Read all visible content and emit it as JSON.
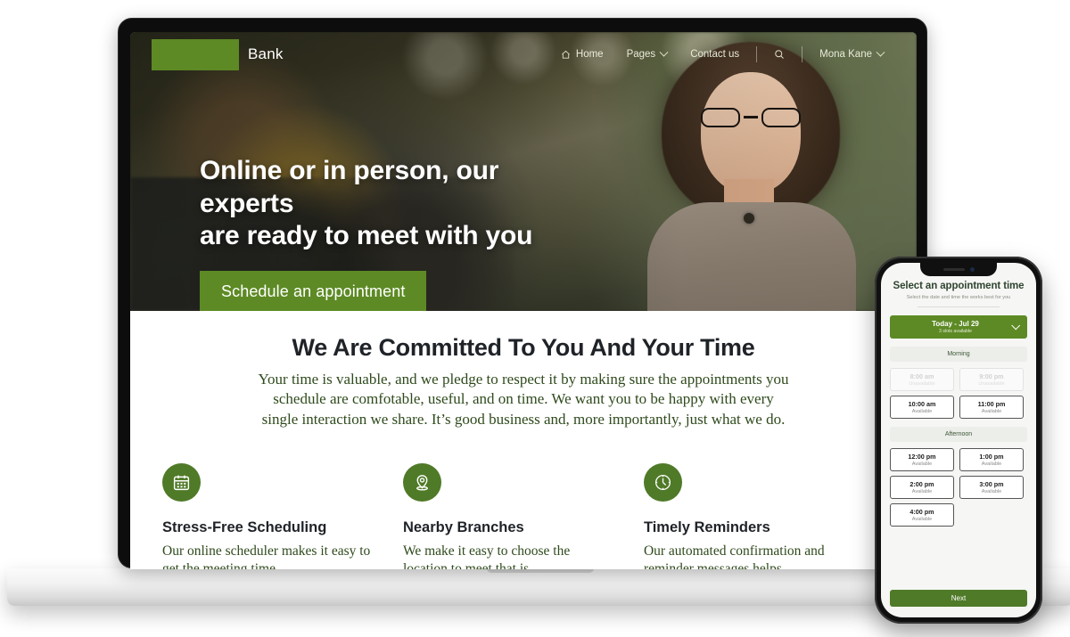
{
  "desktop": {
    "nav": {
      "logo_text": "Bank",
      "items": [
        {
          "label": "Home",
          "icon": "home-icon",
          "has_chevron": false
        },
        {
          "label": "Pages",
          "icon": "",
          "has_chevron": true
        },
        {
          "label": "Contact us",
          "icon": "",
          "has_chevron": false
        }
      ],
      "search_icon": "search-icon",
      "account_label": "Mona Kane",
      "account_chevron": "chevron-down-icon"
    },
    "hero": {
      "headline_line1": "Online or in person, our experts",
      "headline_line2": "are ready to meet with you",
      "cta_label": "Schedule an appointment"
    },
    "section": {
      "title": "We Are Committed To You And Your Time",
      "body": "Your time is valuable, and we pledge to respect it by making sure the appointments you schedule are comfotable, useful, and on time. We want you to be happy with every single interaction we share. It’s good business and, more importantly, just what we do.",
      "features": [
        {
          "icon": "calendar-icon",
          "title": "Stress-Free Scheduling",
          "text": "Our online scheduler makes it easy to get the meeting time"
        },
        {
          "icon": "location-pin-icon",
          "title": "Nearby Branches",
          "text": "We make it easy to choose the location to meet that is"
        },
        {
          "icon": "clock-icon",
          "title": "Timely Reminders",
          "text": "Our automated confirmation and reminder messages helps"
        }
      ]
    }
  },
  "phone": {
    "title": "Select an appointment time",
    "subtitle": "Select the date and time the works best for you",
    "date_select": {
      "label": "Today - Jul 29",
      "sublabel": "3 slots available",
      "chevron": "chevron-down-icon"
    },
    "groups": [
      {
        "label": "Morning",
        "slots": [
          {
            "time": "8:00 am",
            "status": "Unavailable",
            "available": false
          },
          {
            "time": "9:00 pm",
            "status": "Unavailable",
            "available": false
          },
          {
            "time": "10:00 am",
            "status": "Available",
            "available": true
          },
          {
            "time": "11:00 pm",
            "status": "Available",
            "available": true
          }
        ]
      },
      {
        "label": "Afternoon",
        "slots": [
          {
            "time": "12:00 pm",
            "status": "Available",
            "available": true
          },
          {
            "time": "1:00 pm",
            "status": "Available",
            "available": true
          },
          {
            "time": "2:00 pm",
            "status": "Available",
            "available": true
          },
          {
            "time": "3:00 pm",
            "status": "Available",
            "available": true
          },
          {
            "time": "4:00 pm",
            "status": "Available",
            "available": true
          }
        ]
      }
    ],
    "next_label": "Next"
  },
  "colors": {
    "brand_green": "#5d8a24",
    "icon_green": "#4f7a28",
    "body_green": "#2f4a1c",
    "heading_dark": "#1f2328"
  }
}
